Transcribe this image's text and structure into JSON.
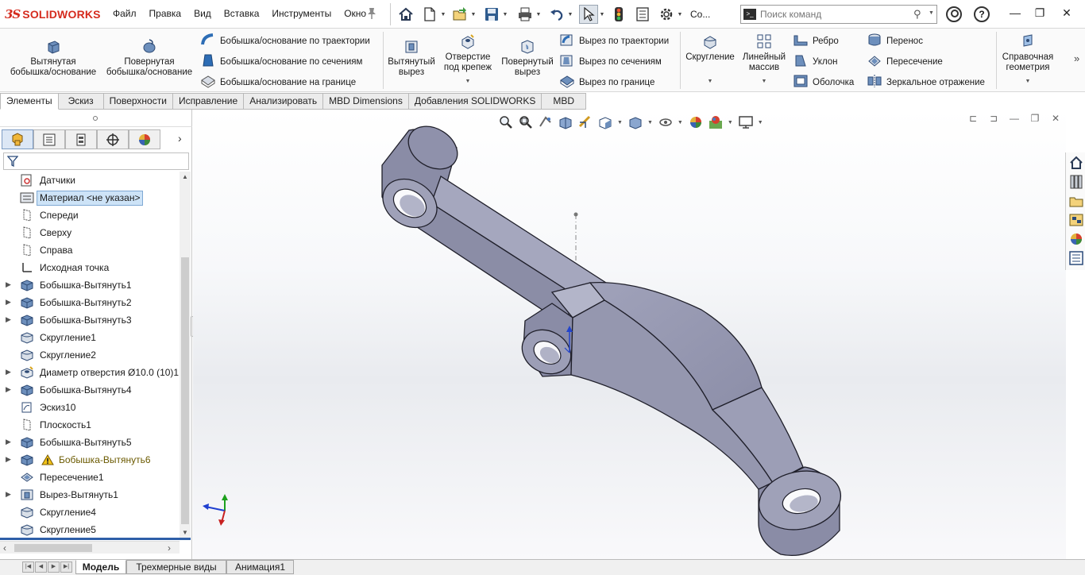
{
  "app": {
    "brand_mark": "3S",
    "brand_name": "SOLIDWORKS"
  },
  "menu": [
    "Файл",
    "Правка",
    "Вид",
    "Вставка",
    "Инструменты",
    "Окно"
  ],
  "quick_access": {
    "overflow_label": "Со...",
    "icons": [
      "home-icon",
      "new-document-icon",
      "open-icon",
      "save-icon",
      "print-icon",
      "undo-icon",
      "select-icon",
      "traffic-light-icon",
      "file-properties-icon",
      "options-gear-icon"
    ]
  },
  "search": {
    "placeholder": "Поиск команд"
  },
  "ribbon": {
    "extruded_boss": "Вытянутая\nбобышка/основание",
    "revolved_boss": "Повернутая\nбобышка/основание",
    "swept_boss": "Бобышка/основание по траектории",
    "lofted_boss": "Бобышка/основание по сечениям",
    "boundary_boss": "Бобышка/основание на границе",
    "extruded_cut": "Вытянутый\nвырез",
    "hole_wizard": "Отверстие\nпод крепеж",
    "revolved_cut": "Повернутый\nвырез",
    "swept_cut": "Вырез по траектории",
    "lofted_cut": "Вырез по сечениям",
    "boundary_cut": "Вырез по границе",
    "fillet": "Скругление",
    "linear_pattern": "Линейный\nмассив",
    "rib": "Ребро",
    "draft": "Уклон",
    "shell": "Оболочка",
    "wrap": "Перенос",
    "intersect": "Пересечение",
    "mirror": "Зеркальное отражение",
    "ref_geometry": "Справочная\nгеометрия"
  },
  "tabs": [
    "Элементы",
    "Эскиз",
    "Поверхности",
    "Исправление",
    "Анализировать",
    "MBD Dimensions",
    "Добавления SOLIDWORKS",
    "MBD"
  ],
  "active_tab": "Элементы",
  "feature_tree": [
    {
      "label": "Датчики",
      "icon": "sensors-icon",
      "expandable": false
    },
    {
      "label": "Материал <не указан>",
      "icon": "material-icon",
      "expandable": false,
      "selected": true
    },
    {
      "label": "Спереди",
      "icon": "plane-icon",
      "expandable": false
    },
    {
      "label": "Сверху",
      "icon": "plane-icon",
      "expandable": false
    },
    {
      "label": "Справа",
      "icon": "plane-icon",
      "expandable": false
    },
    {
      "label": "Исходная точка",
      "icon": "origin-icon",
      "expandable": false
    },
    {
      "label": "Бобышка-Вытянуть1",
      "icon": "extrude-icon",
      "expandable": true
    },
    {
      "label": "Бобышка-Вытянуть2",
      "icon": "extrude-icon",
      "expandable": true
    },
    {
      "label": "Бобышка-Вытянуть3",
      "icon": "extrude-icon",
      "expandable": true
    },
    {
      "label": "Скругление1",
      "icon": "fillet-icon",
      "expandable": false
    },
    {
      "label": "Скругление2",
      "icon": "fillet-icon",
      "expandable": false
    },
    {
      "label": "Диаметр отверстия Ø10.0 (10)1",
      "icon": "hole-icon",
      "expandable": true
    },
    {
      "label": "Бобышка-Вытянуть4",
      "icon": "extrude-icon",
      "expandable": true
    },
    {
      "label": "Эскиз10",
      "icon": "sketch-icon",
      "expandable": false
    },
    {
      "label": "Плоскость1",
      "icon": "plane-icon",
      "expandable": false
    },
    {
      "label": "Бобышка-Вытянуть5",
      "icon": "extrude-icon",
      "expandable": true
    },
    {
      "label": "Бобышка-Вытянуть6",
      "icon": "extrude-icon",
      "expandable": true,
      "warning": true
    },
    {
      "label": "Пересечение1",
      "icon": "intersect-icon",
      "expandable": false
    },
    {
      "label": "Вырез-Вытянуть1",
      "icon": "cut-extrude-icon",
      "expandable": true
    },
    {
      "label": "Скругление4",
      "icon": "fillet-icon",
      "expandable": false
    },
    {
      "label": "Скругление5",
      "icon": "fillet-icon",
      "expandable": false
    }
  ],
  "bottom_tabs": [
    "Модель",
    "Трехмерные виды",
    "Анимация1"
  ],
  "active_bottom_tab": "Модель",
  "colors": {
    "brand": "#d52b1e",
    "accent": "#2e5fa8",
    "part": "#9a9cb2",
    "part_dark": "#6f7188",
    "part_light": "#b9bbcd"
  }
}
